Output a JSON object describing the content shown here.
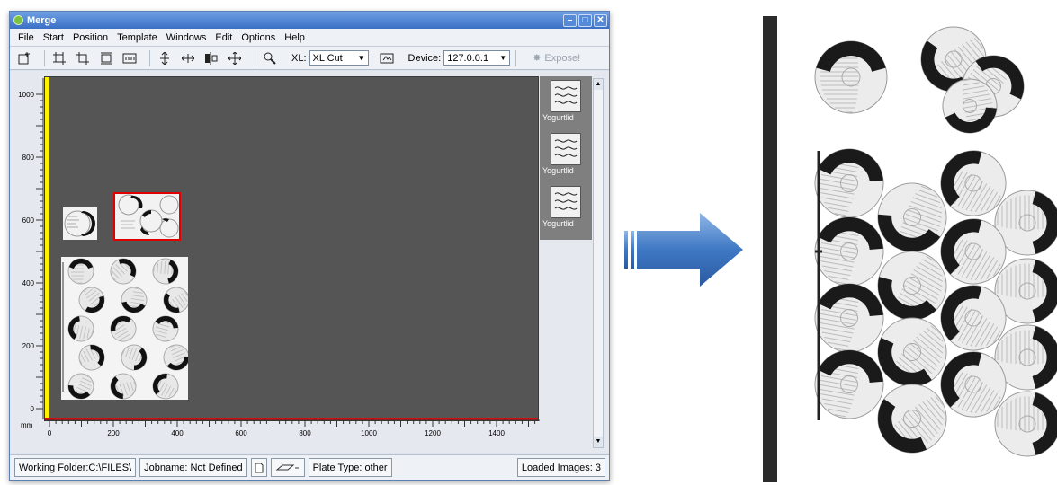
{
  "window": {
    "title": "Merge"
  },
  "menu": [
    "File",
    "Start",
    "Position",
    "Template",
    "Windows",
    "Edit",
    "Options",
    "Help"
  ],
  "toolbar": {
    "xl_label": "XL:",
    "xl_value": "XL Cut",
    "device_label": "Device:",
    "device_value": "127.0.0.1",
    "expose_label": "Expose!"
  },
  "ruler": {
    "unit": "mm",
    "v_ticks": [
      "1000",
      "800",
      "600",
      "400",
      "200",
      "0"
    ],
    "h_ticks": [
      "0",
      "200",
      "400",
      "600",
      "800",
      "1000",
      "1200",
      "1400"
    ]
  },
  "thumbnails": [
    {
      "label": "Yogurtlid"
    },
    {
      "label": "Yogurtlid"
    },
    {
      "label": "Yogurtlid"
    }
  ],
  "status": {
    "working_folder": "Working Folder:C:\\FILES\\",
    "jobname": "Jobname: Not Defined",
    "plate_type": "Plate Type: other",
    "loaded_images": "Loaded Images: 3"
  },
  "colors": {
    "canvas": "#555555",
    "selection": "#e00000",
    "title_bar": "#3b6fc4",
    "arrow": "#3f78c4"
  },
  "icons": [
    "new-icon",
    "crop-icon",
    "trim-icon",
    "fit-icon",
    "grid-icon",
    "align-vertical-icon",
    "align-horizontal-icon",
    "distribute-icon",
    "move-icon",
    "zoom-icon",
    "preview-icon",
    "expose-icon"
  ]
}
